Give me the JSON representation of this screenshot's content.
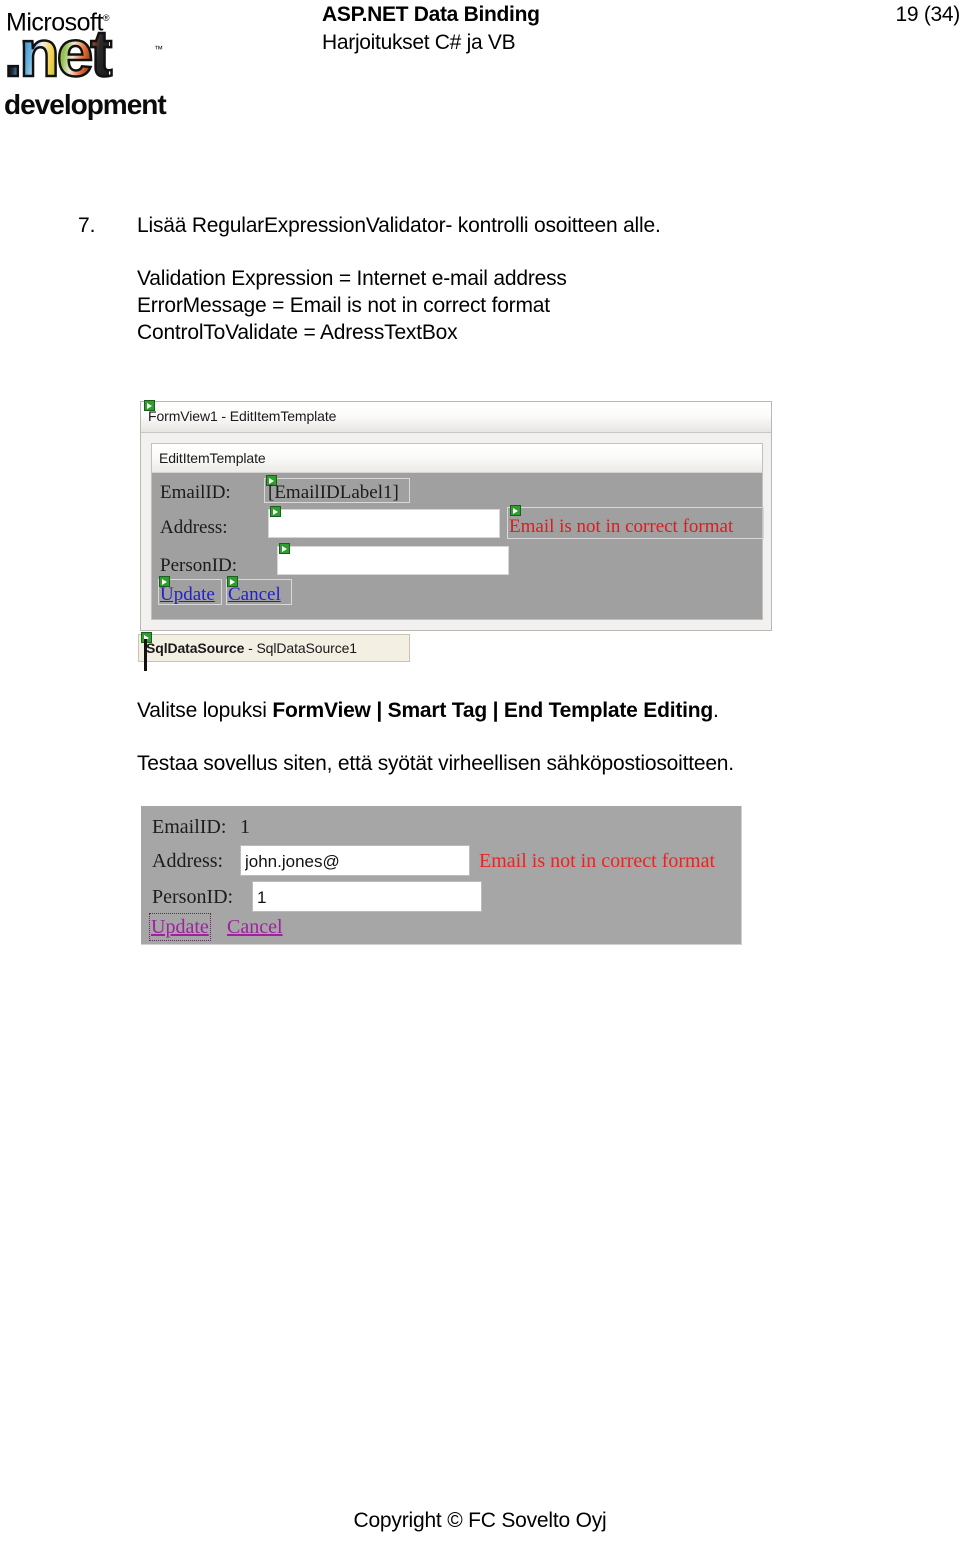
{
  "header": {
    "logo": {
      "microsoft": "Microsoft",
      "dotnet": ".net",
      "development": "development",
      "tm": "™"
    },
    "title": "ASP.NET Data Binding",
    "subtitle": "Harjoitukset C# ja VB",
    "page_number": "19 (34)"
  },
  "content": {
    "step": {
      "number": "7.",
      "text": "Lisää RegularExpressionValidator- kontrolli osoitteen alle."
    },
    "properties": [
      "Validation Expression = Internet e-mail address",
      "ErrorMessage = Email is not in correct format",
      "ControlToValidate = AdressTextBox"
    ],
    "paragraph_finish_pre": "Valitse lopuksi ",
    "paragraph_finish_bold": "FormView | Smart Tag | End Template Editing",
    "paragraph_finish_post": ".",
    "paragraph_test": "Testaa sovellus siten, että syötät virheellisen sähköpostiosoitteen."
  },
  "designer_screenshot": {
    "outer_panel_title": "FormView1 - EditItemTemplate",
    "inner_panel_title": "EditItemTemplate",
    "rows": {
      "emailid_label": "EmailID:",
      "emailid_value": "[EmailIDLabel1]",
      "address_label": "Address:",
      "address_value": "",
      "error_message": "Email is not in correct format",
      "personid_label": "PersonID:",
      "personid_value": ""
    },
    "commands": {
      "update": "Update",
      "cancel": "Cancel"
    },
    "datasource_bold": "SqlDataSource",
    "datasource_rest": " - SqlDataSource1",
    "smart_tag_icon": "smart-tag-icon"
  },
  "browser_screenshot": {
    "emailid_label": "EmailID:",
    "emailid_value": "1",
    "address_label": "Address:",
    "address_value": "john.jones@",
    "error_message": "Email is not in correct format",
    "personid_label": "PersonID:",
    "personid_value": "1",
    "update_link": "Update",
    "cancel_link": "Cancel"
  },
  "footer": {
    "copyright": "Copyright ©  FC Sovelto Oyj"
  },
  "colors": {
    "error_red": "#ee2222",
    "designer_link_blue": "#2020d0",
    "browser_link_purple": "#a020a0",
    "form_surface_gray": "#a0a0a0",
    "smart_tag_green": "#2f9e2f"
  }
}
